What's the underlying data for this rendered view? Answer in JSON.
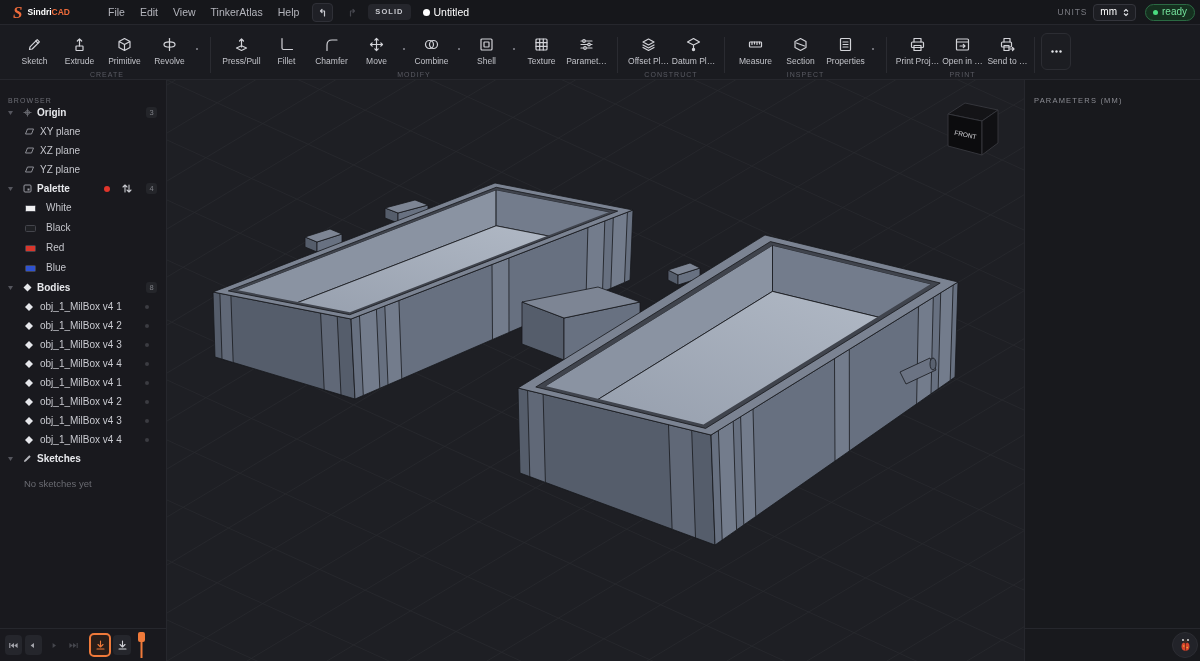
{
  "app": {
    "logo_mark": "S",
    "name": "Sindri",
    "name_accent": "CAD"
  },
  "menu": [
    {
      "label": "File"
    },
    {
      "label": "Edit"
    },
    {
      "label": "View"
    },
    {
      "label": "TinkerAtlas"
    },
    {
      "label": "Help"
    }
  ],
  "history": [
    {
      "kind": "undo",
      "disabled": false
    },
    {
      "kind": "redo",
      "disabled": true
    }
  ],
  "mode_badge": "SOLID",
  "document": {
    "title": "Untitled"
  },
  "units": {
    "label": "UNITS",
    "value": "mm"
  },
  "status": {
    "label": "ready"
  },
  "toolbar": {
    "groups": [
      {
        "label": "CREATE",
        "tools": [
          {
            "label": "Sketch",
            "has_menu": false
          },
          {
            "label": "Extrude",
            "has_menu": false
          },
          {
            "label": "Primitive",
            "has_menu": false
          },
          {
            "label": "Revolve",
            "has_menu": true
          }
        ]
      },
      {
        "label": "MODIFY",
        "tools": [
          {
            "label": "Press/Pull",
            "has_menu": false
          },
          {
            "label": "Fillet",
            "has_menu": false
          },
          {
            "label": "Chamfer",
            "has_menu": false
          },
          {
            "label": "Move",
            "has_menu": true
          },
          {
            "label": "Combine",
            "has_menu": true
          },
          {
            "label": "Shell",
            "has_menu": true
          },
          {
            "label": "Texture",
            "has_menu": false
          },
          {
            "label": "Paramet…",
            "has_menu": false
          }
        ]
      },
      {
        "label": "CONSTRUCT",
        "tools": [
          {
            "label": "Offset Pl…",
            "has_menu": false
          },
          {
            "label": "Datum Pl…",
            "has_menu": false
          }
        ]
      },
      {
        "label": "INSPECT",
        "tools": [
          {
            "label": "Measure",
            "has_menu": false
          },
          {
            "label": "Section",
            "has_menu": false
          },
          {
            "label": "Properties",
            "has_menu": true
          }
        ]
      },
      {
        "label": "PRINT",
        "tools": [
          {
            "label": "Print Proj…",
            "has_menu": false
          },
          {
            "label": "Open in …",
            "has_menu": false
          },
          {
            "label": "Send to …",
            "has_menu": false
          }
        ]
      }
    ]
  },
  "browser": {
    "title": "BROWSER",
    "tree": [
      {
        "kind": "origin",
        "label": "Origin",
        "count": "3",
        "expanded": true,
        "modified": false,
        "children": [
          {
            "kind": "plane",
            "label": "XY plane"
          },
          {
            "kind": "plane",
            "label": "XZ plane"
          },
          {
            "kind": "plane",
            "label": "YZ plane"
          }
        ]
      },
      {
        "kind": "palette",
        "label": "Palette",
        "count": "4",
        "expanded": true,
        "modified": true,
        "children": [
          {
            "kind": "swatch",
            "label": "White",
            "color": "#f0f0f2"
          },
          {
            "kind": "swatch",
            "label": "Black",
            "color": "#1f2024"
          },
          {
            "kind": "swatch",
            "label": "Red",
            "color": "#d8362c"
          },
          {
            "kind": "swatch",
            "label": "Blue",
            "color": "#2f52cf"
          }
        ]
      },
      {
        "kind": "bodies",
        "label": "Bodies",
        "count": "8",
        "expanded": true,
        "modified": false,
        "children": [
          {
            "kind": "body",
            "label": "obj_1_MilBox v4 1"
          },
          {
            "kind": "body",
            "label": "obj_1_MilBox v4 2"
          },
          {
            "kind": "body",
            "label": "obj_1_MilBox v4 3"
          },
          {
            "kind": "body",
            "label": "obj_1_MilBox v4 4"
          },
          {
            "kind": "body",
            "label": "obj_1_MilBox v4 1"
          },
          {
            "kind": "body",
            "label": "obj_1_MilBox v4 2"
          },
          {
            "kind": "body",
            "label": "obj_1_MilBox v4 3"
          },
          {
            "kind": "body",
            "label": "obj_1_MilBox v4 4"
          }
        ]
      },
      {
        "kind": "sketches",
        "label": "Sketches",
        "expanded": true,
        "modified": false,
        "empty_text": "No sketches yet"
      }
    ]
  },
  "timeline": {
    "controls": [
      {
        "kind": "first",
        "disabled": false
      },
      {
        "kind": "prev",
        "disabled": false
      },
      {
        "kind": "next",
        "disabled": true
      },
      {
        "kind": "last",
        "disabled": true
      }
    ],
    "steps": [
      {
        "selected": true
      },
      {
        "selected": false
      }
    ]
  },
  "viewport": {
    "view_cube": {
      "front_label": "FRONT"
    }
  },
  "parameters": {
    "title": "PARAMETERS (MM)"
  }
}
